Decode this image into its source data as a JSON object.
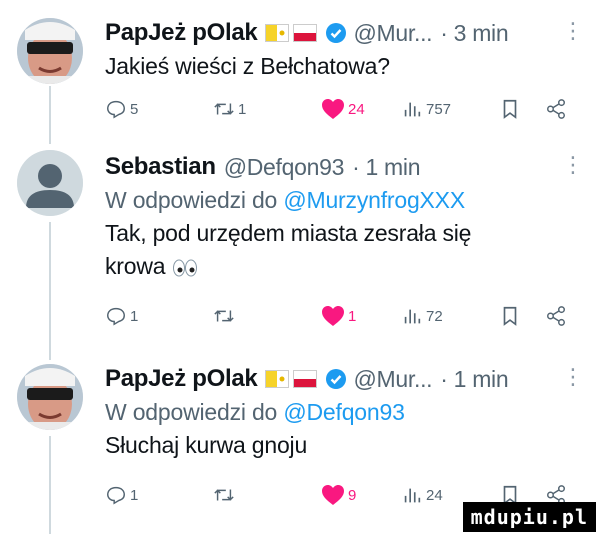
{
  "tweets": [
    {
      "name": "PapJeż pOlak",
      "handle": "@Mur...",
      "time": "3 min",
      "body": [
        "Jakieś wieści z Bełchatowa?"
      ],
      "actions": {
        "replies": "5",
        "retweets": "1",
        "likes": "24",
        "views": "757"
      }
    },
    {
      "name": "Sebastian",
      "handle": "@Defqon93",
      "time": "1 min",
      "reply_prefix": "W odpowiedzi do",
      "reply_to": "@MurzynfrogXXX",
      "body": [
        "Tak, pod urzędem miasta zesrała się",
        "krowa"
      ],
      "actions": {
        "replies": "1",
        "retweets": "",
        "likes": "1",
        "views": "72"
      }
    },
    {
      "name": "PapJeż pOlak",
      "handle": "@Mur...",
      "time": "1 min",
      "reply_prefix": "W odpowiedzi do",
      "reply_to": "@Defqon93",
      "body": [
        "Słuchaj kurwa gnoju"
      ],
      "actions": {
        "replies": "1",
        "retweets": "",
        "likes": "9",
        "views": "24"
      }
    }
  ],
  "separator": "·",
  "menu": "⋮",
  "watermark": "mdupiu.pl",
  "icons": [
    "reply-icon",
    "retweet-icon",
    "heart-icon",
    "views-icon",
    "bookmark-icon",
    "share-icon",
    "vatican-flag-icon",
    "poland-flag-icon",
    "verified-badge-icon",
    "eyes-emoji-icon"
  ],
  "colors": {
    "accent": "#1d9bf0",
    "like": "#f91880",
    "muted": "#536471",
    "thread": "#cfd9de"
  }
}
